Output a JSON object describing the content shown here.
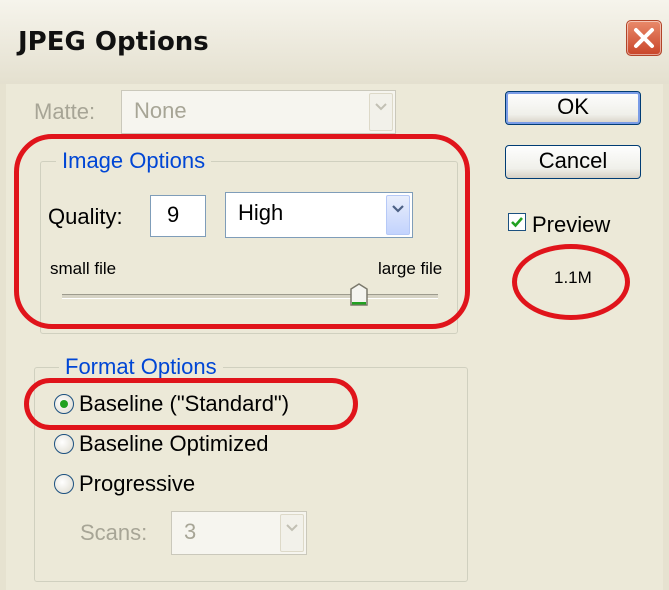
{
  "window": {
    "title": "JPEG Options"
  },
  "matte": {
    "label": "Matte:",
    "value": "None"
  },
  "buttons": {
    "ok": "OK",
    "cancel": "Cancel"
  },
  "preview": {
    "label": "Preview",
    "checked": true,
    "size": "1.1M"
  },
  "image_options": {
    "group_label": "Image Options",
    "quality_label": "Quality:",
    "quality_value": "9",
    "quality_preset": "High",
    "small_label": "small file",
    "large_label": "large file",
    "slider_fraction": 0.79
  },
  "format_options": {
    "group_label": "Format Options",
    "options": [
      "Baseline (\"Standard\")",
      "Baseline Optimized",
      "Progressive"
    ],
    "selected_index": 0,
    "scans_label": "Scans:",
    "scans_value": "3"
  },
  "colors": {
    "annotation": "#e0141b",
    "accent": "#0046d5",
    "check": "#21a121"
  }
}
